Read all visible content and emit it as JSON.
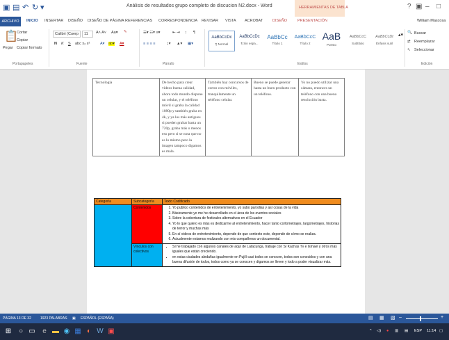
{
  "title_bar": {
    "document_title": "Análisis de resultados grupo completo de discucion N2.docx - Word",
    "context_group": "HERRAMIENTAS DE TABLA",
    "window_controls": [
      "?",
      "▣",
      "–",
      "□"
    ]
  },
  "tabs": {
    "archivo": "ARCHIVO",
    "inicio": "INICIO",
    "insertar": "INSERTAR",
    "diseno": "DISEÑO",
    "diseno_pagina": "DISEÑO DE PÁGINA",
    "referencias": "REFERENCIAS",
    "correspondencia": "CORRESPONDENCIA",
    "revisar": "REVISAR",
    "vista": "VISTA",
    "acrobat": "ACROBAT",
    "ctx_diseno": "DISEÑO",
    "ctx_presentacion": "PRESENTACIÓN",
    "user": "William Mascosa"
  },
  "ribbon": {
    "clipboard": {
      "paste": "Pegar",
      "cut": "Cortar",
      "copy": "Copiar",
      "format": "Copiar formato",
      "label": "Portapapeles"
    },
    "font": {
      "name": "Calibri (Cuerp",
      "size": "11",
      "bold": "N",
      "italic": "K",
      "underline": "S",
      "label": "Fuente"
    },
    "paragraph": {
      "label": "Párrafo"
    },
    "styles": {
      "label": "Estilos",
      "items": [
        {
          "sample": "AaBbCcDc",
          "name": "¶ Normal"
        },
        {
          "sample": "AaBbCcDc",
          "name": "¶ Sin espa..."
        },
        {
          "sample": "AaBbCc",
          "name": "Título 1"
        },
        {
          "sample": "AaBbCcC",
          "name": "Título 2"
        },
        {
          "sample": "AaB",
          "name": "Puesto"
        },
        {
          "sample": "AaBbCcC",
          "name": "Subtítulo"
        },
        {
          "sample": "AaBbCcDt",
          "name": "Énfasis sutil"
        }
      ]
    },
    "editing": {
      "find": "Buscar",
      "replace": "Reemplazar",
      "select": "Seleccionar",
      "label": "Edición"
    }
  },
  "table1": {
    "category": "Tecnología",
    "cells": [
      "De hecho para crear videos buena calidad, ahora todo mundo dispone un celular, y el teléfono móvil si graba la calidad 1080p y también graba en 4k, y ya los más antiguos si pueden grabar hasta un 720p, graba más o menos eso pero si se nota que no es lo mismo pero la imagen tampoco digamos es mala.",
      "También hay concursos de cortos con móviles, tranquilamente un teléfono celular.",
      "Bueno se puede generar hasta un buen producto con un teléfono.",
      "Yo no puedo utilizar una cámara, entonces un teléfono con una buena resolución basta."
    ]
  },
  "table2": {
    "headers": [
      "Categoría",
      "Subcategoría",
      "Texto Codificado"
    ],
    "rows": [
      {
        "subcategory": "Contenidos",
        "items": [
          "Yo publico contenidos de entretenimiento, yo subo parodias y así cosas de la vida",
          "Básicamente yo me he desarrollado en el área de los eventos sociales",
          "Sobre la cobertura de festivales alternativos en el Ecuador",
          "Yo lo que quiero es más es dedicarme al entretenimiento, hacer tanto cortometrajes, largometrajes, historias de terror y muchas más",
          "En sí videos de entretenimiento, depende de que contexto este, depende de cómo se realiza.",
          "Actualmente estamos realizando con mis compañeros un documental."
        ]
      },
      {
        "subcategory": "Vínculos con colectivos",
        "items": [
          "Sí he trabajado con algunos canales de aquí de Latacunga, trabaje con Sí Kachas Tv e Ismael y otros más iguales que están creciendo.",
          "en estas ciudades aledañas igualmente en Pujilí casi todos se conocen, todos son conocidos y con una buena difusión de todos, todos como ya se conocen y digamos se lleven y todo a poder visualizar más."
        ]
      }
    ]
  },
  "status_bar": {
    "page": "PÁGINA 13 DE 32",
    "words": "1923 PALABRAS",
    "language": "ESPAÑOL (ESPAÑA)"
  },
  "taskbar": {
    "lang": "ESP",
    "time": "11:14"
  }
}
